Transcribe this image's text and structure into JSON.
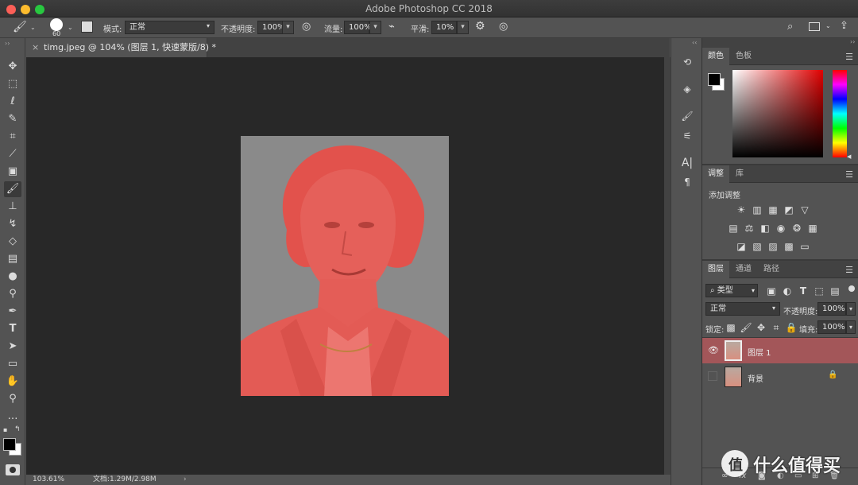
{
  "window": {
    "title": "Adobe Photoshop CC 2018"
  },
  "options": {
    "brush_size": "60",
    "mode_label": "模式:",
    "mode_value": "正常",
    "opacity_label": "不透明度:",
    "opacity_value": "100%",
    "flow_label": "流量:",
    "flow_value": "100%",
    "smooth_label": "平滑:",
    "smooth_value": "10%"
  },
  "document": {
    "tab_title": "timg.jpeg @ 104% (图层 1, 快速蒙版/8) *",
    "zoom": "103.61%",
    "doc_size": "文档:1.29M/2.98M"
  },
  "toolbox": [
    "move-tool",
    "marquee-tool",
    "lasso-tool",
    "quick-select-tool",
    "crop-tool",
    "eyedropper-tool",
    "healing-brush-tool",
    "brush-tool",
    "clone-stamp-tool",
    "history-brush-tool",
    "eraser-tool",
    "gradient-tool",
    "blur-tool",
    "dodge-tool",
    "pen-tool",
    "type-tool",
    "path-select-tool",
    "rectangle-tool",
    "hand-tool",
    "zoom-tool",
    "more-tools"
  ],
  "colors": {
    "foreground": "#000000",
    "background": "#ffffff",
    "mask_overlay": "#e85050",
    "canvas_bg": "#282828",
    "accent_layer": "#a35659"
  },
  "color_panel": {
    "tabs": [
      "颜色",
      "色板"
    ]
  },
  "adjust_panel": {
    "tabs": [
      "调整",
      "库"
    ],
    "add_label": "添加调整"
  },
  "layers_panel": {
    "tabs": [
      "图层",
      "通道",
      "路径"
    ],
    "filter_kind": "类型",
    "blend_mode": "正常",
    "opacity_label": "不透明度:",
    "opacity_value": "100%",
    "lock_label": "锁定:",
    "fill_label": "填充:",
    "fill_value": "100%",
    "layers": [
      {
        "name": "图层 1",
        "visible": true,
        "selected": true
      },
      {
        "name": "背景",
        "visible": false,
        "locked": true
      }
    ]
  },
  "watermark": "什么值得买"
}
